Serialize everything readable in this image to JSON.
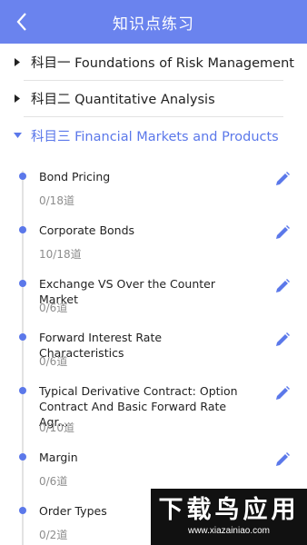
{
  "header": {
    "title": "知识点练习",
    "back_icon": "chevron-left-icon"
  },
  "subjects": [
    {
      "label": "科目一 Foundations of Risk Management",
      "expanded": false
    },
    {
      "label": "科目二 Quantitative Analysis",
      "expanded": false
    },
    {
      "label": "科目三 Financial Markets and Products",
      "expanded": true
    }
  ],
  "topics": [
    {
      "name": "Bond Pricing",
      "count": "0/18道"
    },
    {
      "name": "Corporate Bonds",
      "count": "10/18道"
    },
    {
      "name": "Exchange VS Over the Counter Market",
      "count": "0/6道"
    },
    {
      "name": "Forward Interest Rate Characteristics",
      "count": "0/6道"
    },
    {
      "name": "Typical Derivative Contract: Option Contract And Basic Forward Rate Agr...",
      "count": "0/10道"
    },
    {
      "name": "Margin",
      "count": "0/6道"
    },
    {
      "name": "Order Types",
      "count": "0/2道"
    }
  ],
  "watermark": {
    "title": "下载鸟应用",
    "url": "www.xiazainiao.com"
  },
  "colors": {
    "accent": "#5b78ea",
    "header": "#6a83ee"
  }
}
